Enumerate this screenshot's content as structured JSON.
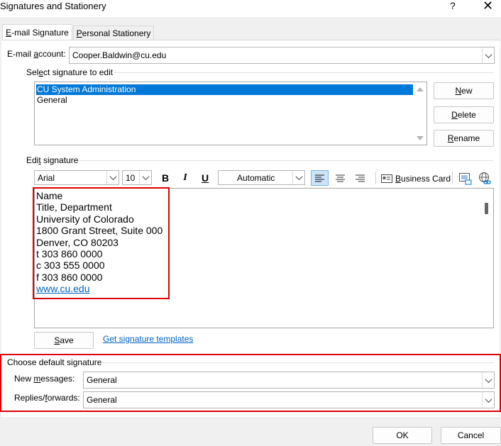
{
  "window": {
    "title": "Signatures and Stationery",
    "help_glyph": "?",
    "close_glyph": "✕"
  },
  "tabs": [
    {
      "label": "E-mail Signature",
      "underline": "E",
      "active": true
    },
    {
      "label": "Personal Stationery",
      "underline": "P",
      "active": false
    }
  ],
  "email_account": {
    "label_pre": "E-mail ",
    "label_u": "a",
    "label_post": "ccount:",
    "value": "Cooper.Baldwin@cu.edu"
  },
  "select_signature": {
    "label_pre": "Sel",
    "label_u": "e",
    "label_post": "ct signature to edit",
    "items": [
      "CU System Administration",
      "General"
    ],
    "selected_index": 0
  },
  "side_buttons": {
    "new": {
      "label": "New",
      "underline": "N"
    },
    "delete": {
      "label": "Delete",
      "underline": "D"
    },
    "rename": {
      "label": "Rename",
      "underline": "R"
    }
  },
  "edit_signature": {
    "label_pre": "Edi",
    "label_u": "t",
    "label_post": " signature"
  },
  "toolbar": {
    "font": "Arial",
    "size": "10",
    "bold": "B",
    "italic": "I",
    "underline": "U",
    "color": "Automatic",
    "business_card_label": "Business Card",
    "business_card_underline": "B"
  },
  "signature_text": {
    "lines": [
      "Name",
      "Title, Department",
      "University of Colorado",
      "1800 Grant Street, Suite 000",
      "Denver, CO 80203",
      "t 303 860 0000",
      "c 303 555 0000",
      "f 303 860 0000"
    ],
    "link": "www.cu.edu"
  },
  "save_button": {
    "label": "Save",
    "underline": "S"
  },
  "templates_link": "Get signature templates",
  "default_signature": {
    "title": "Choose default signature",
    "new_messages_pre": "New ",
    "new_messages_u": "m",
    "new_messages_post": "essages:",
    "new_messages_value": "General",
    "replies_pre": "Replies/",
    "replies_u": "f",
    "replies_post": "orwards:",
    "replies_value": "General"
  },
  "footer": {
    "ok": "OK",
    "cancel": "Cancel"
  },
  "colors": {
    "highlight_box": "#e00000",
    "selection": "#0078d7",
    "link": "#0563c1"
  }
}
